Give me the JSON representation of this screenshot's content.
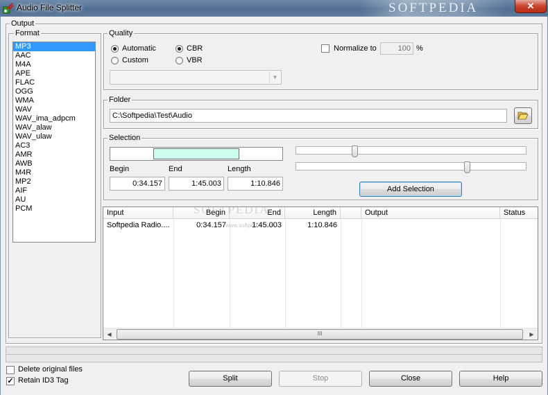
{
  "window": {
    "title": "Audio File Splitter",
    "watermark": "SOFTPEDIA",
    "close_glyph": "✕"
  },
  "output": {
    "label": "Output",
    "format": {
      "label": "Format",
      "items": [
        "MP3",
        "AAC",
        "M4A",
        "APE",
        "FLAC",
        "OGG",
        "WMA",
        "WAV",
        "WAV_ima_adpcm",
        "WAV_alaw",
        "WAV_ulaw",
        "AC3",
        "AMR",
        "AWB",
        "M4R",
        "MP2",
        "AIF",
        "AU",
        "PCM"
      ],
      "selected": "MP3"
    }
  },
  "quality": {
    "label": "Quality",
    "automatic": "Automatic",
    "custom": "Custom",
    "cbr": "CBR",
    "vbr": "VBR",
    "normalize_label": "Normalize to",
    "normalize_value": "100",
    "normalize_unit": "%",
    "preset_value": ""
  },
  "folder": {
    "label": "Folder",
    "path": "C:\\Softpedia\\Test\\Audio",
    "browse_icon": "folder-open-icon"
  },
  "selection": {
    "label": "Selection",
    "begin_label": "Begin",
    "end_label": "End",
    "length_label": "Length",
    "begin": "0:34.157",
    "end": "1:45.003",
    "length": "1:10.846",
    "add_button": "Add Selection",
    "range_fraction": [
      0.25,
      0.75
    ],
    "slider_start_fraction": 0.25,
    "slider_end_fraction": 0.75
  },
  "table": {
    "columns": [
      "Input",
      "Begin",
      "End",
      "Length",
      "",
      "Output",
      "Status"
    ],
    "rows": [
      {
        "input": "Softpedia Radio....",
        "begin": "0:34.157",
        "end": "1:45.003",
        "length": "1:10.846",
        "blank": "",
        "output": "",
        "status": ""
      }
    ],
    "watermark": "SOFTPEDIA",
    "watermark_url": "www.softpedia.com",
    "scroll_left": "◀",
    "scroll_right": "▶",
    "scroll_grip": "III"
  },
  "options": {
    "delete_original": {
      "label": "Delete original files",
      "checked": false
    },
    "retain_id3": {
      "label": "Retain ID3 Tag",
      "checked": true
    }
  },
  "buttons": {
    "split": "Split",
    "stop": "Stop",
    "close": "Close",
    "help": "Help"
  },
  "colors": {
    "selection_range": "#ccfff0",
    "list_selected": "#3399ff"
  }
}
